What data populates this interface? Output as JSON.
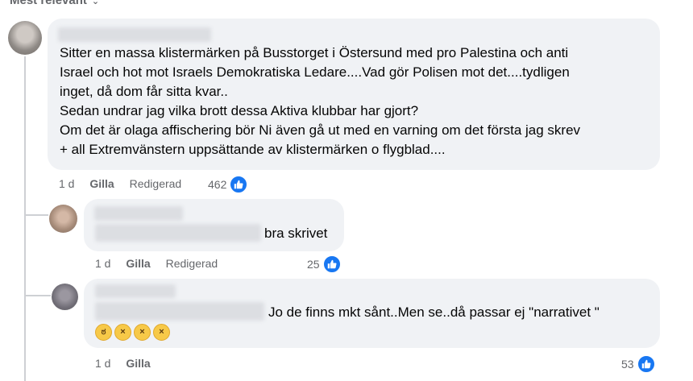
{
  "sort_label": "Mest relevant",
  "comments": [
    {
      "lines": [
        "Sitter en massa klistermärken på Busstorget i Östersund med pro Palestina och anti",
        "Israel och hot mot Israels Demokratiska Ledare....Vad gör Polisen mot det....tydligen",
        "inget, då dom får sitta kvar..",
        "Sedan undrar jag vilka brott dessa Aktiva klubbar har gjort?",
        "Om det är olaga affischering bör Ni även gå ut med en varning om det första jag skrev",
        "+ all Extremvänstern uppsättande av klistermärken o flygblad...."
      ],
      "time": "1 d",
      "like_label": "Gilla",
      "edited_label": "Redigerad",
      "reaction_count": "462"
    },
    {
      "text": "bra skrivet",
      "time": "1 d",
      "like_label": "Gilla",
      "edited_label": "Redigerad",
      "reaction_count": "25"
    },
    {
      "text": "Jo de finns mkt sånt..Men se..då passar ej \"narrativet \"",
      "emojis": [
        "rolling-eyes",
        "squinting-tongue",
        "squinting-tongue",
        "squinting-tongue"
      ],
      "time": "1 d",
      "like_label": "Gilla",
      "reaction_count": "53"
    }
  ],
  "colors": {
    "bubble": "#f0f2f5",
    "meta": "#65676b",
    "like_blue": "#1877f2"
  }
}
